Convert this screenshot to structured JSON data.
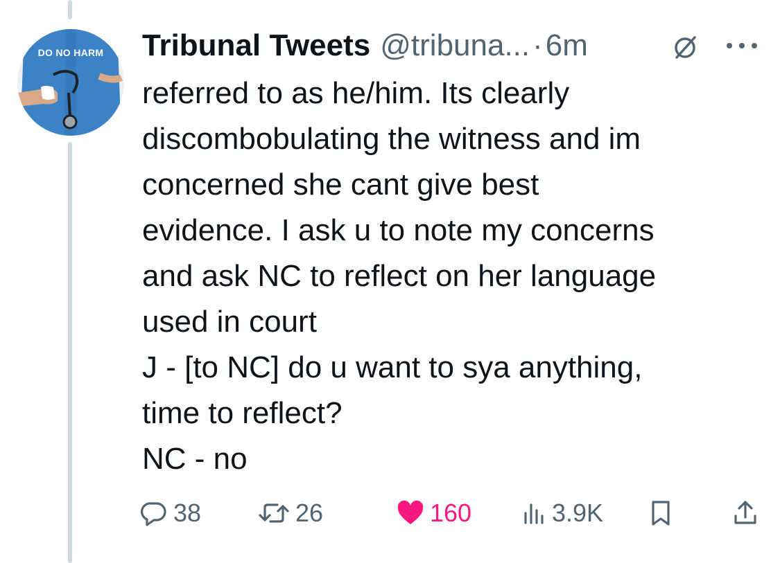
{
  "author": {
    "display_name": "Tribunal Tweets",
    "handle": "@tribuna...",
    "separator": "·",
    "time": "6m",
    "avatar_text": "DO NO HARM",
    "avatar_icon": "nurse-stethoscope-avatar"
  },
  "body": {
    "lines": [
      "referred to as he/him. Its clearly",
      "discombobulating the witness and im",
      "concerned she cant give best",
      "evidence. I ask u to note my concerns",
      "and ask NC to reflect on her language",
      "used in court",
      "J - [to NC] do u want to sya anything,",
      "time to reflect?",
      "NC - no"
    ]
  },
  "actions": {
    "replies": "38",
    "reposts": "26",
    "likes": "160",
    "views": "3.9K"
  },
  "icons": {
    "block": "circle-slash-icon",
    "more": "more-dots-icon",
    "reply": "reply-bubble-icon",
    "repost": "repost-arrows-icon",
    "like": "heart-icon",
    "views": "views-bars-icon",
    "bookmark": "bookmark-icon",
    "share": "share-icon"
  },
  "colors": {
    "text": "#0f1419",
    "secondary": "#536471",
    "like": "#f91880",
    "thread_line": "#cfd9de",
    "avatar_shirt": "#3b82c6"
  }
}
